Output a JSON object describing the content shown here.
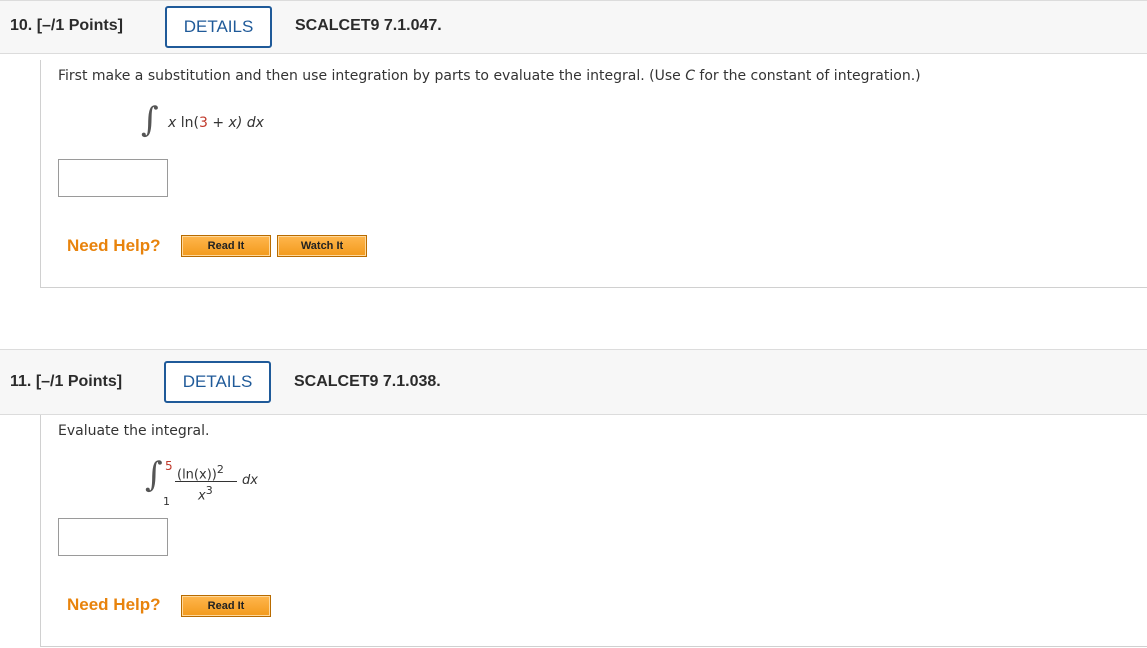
{
  "q10": {
    "number": "10.",
    "points": "[–/1 Points]",
    "details_label": "DETAILS",
    "code": "SCALCET9 7.1.047.",
    "prompt_a": "First make a substitution and then use integration by parts to evaluate the integral. (Use ",
    "prompt_var": "C",
    "prompt_b": " for the constant of integration.)",
    "integral_sign": "∫",
    "integrand_x": "x",
    "integrand_ln": "ln(",
    "integrand_three": "3",
    "integrand_rest": " + x) dx",
    "answer_value": "",
    "need_help": "Need Help?",
    "read_it": "Read It",
    "watch_it": "Watch It"
  },
  "q11": {
    "number": "11.",
    "points": "[–/1 Points]",
    "details_label": "DETAILS",
    "code": "SCALCET9 7.1.038.",
    "prompt": "Evaluate the integral.",
    "integral_sign": "∫",
    "upper_limit": "5",
    "lower_limit": "1",
    "numerator": "(ln(x))",
    "numerator_exp": "2",
    "denominator": "x",
    "denominator_exp": "3",
    "differential": "dx",
    "answer_value": "",
    "need_help": "Need Help?",
    "read_it": "Read It"
  },
  "colors": {
    "details_border": "#1f5a99",
    "need_help": "#e8830c",
    "button_orange": "#f29a1c",
    "highlight_red": "#c0392b"
  }
}
